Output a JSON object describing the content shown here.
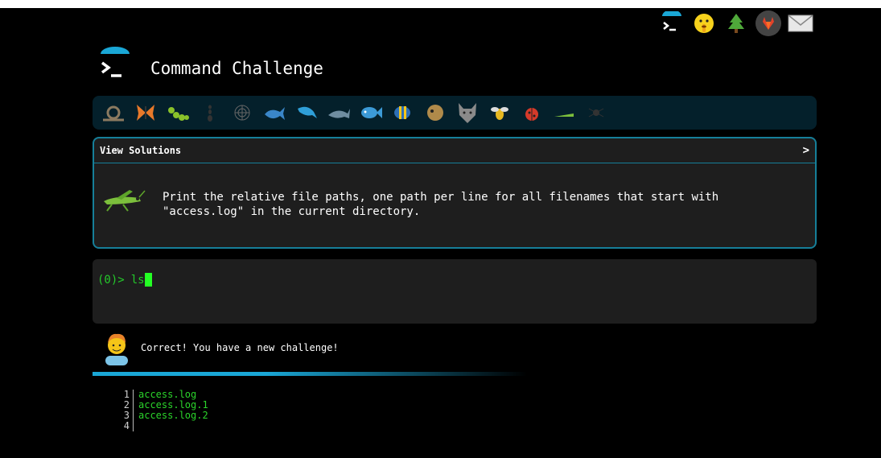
{
  "app": {
    "title": "Command Challenge"
  },
  "top_icons": [
    "terminal-icon",
    "shush-emoji-icon",
    "tree-icon",
    "gitlab-icon",
    "mail-icon"
  ],
  "animals": [
    "snail",
    "butterfly",
    "caterpillar",
    "ant",
    "web",
    "whale",
    "dolphin",
    "dolphin2",
    "fish",
    "tropical-fish",
    "blowfish",
    "wolf",
    "bee",
    "ladybug",
    "grasshopper-small",
    "spider"
  ],
  "challenge": {
    "solutions_label": "View Solutions",
    "text": "Print the relative file paths, one path per line for all filenames that start with \"access.log\" in the current directory."
  },
  "terminal": {
    "prompt": "(0)>",
    "input": "ls"
  },
  "feedback": {
    "message": "Correct! You have a new challenge!"
  },
  "output": {
    "lines": [
      {
        "n": "1",
        "text": "access.log"
      },
      {
        "n": "2",
        "text": "access.log.1"
      },
      {
        "n": "3",
        "text": "access.log.2"
      },
      {
        "n": "4",
        "text": ""
      }
    ]
  },
  "colors": {
    "accent": "#167f99",
    "terminal_green": "#24c92b",
    "panel_bg": "#1e1e1e",
    "animal_bar_bg": "#04202b"
  }
}
